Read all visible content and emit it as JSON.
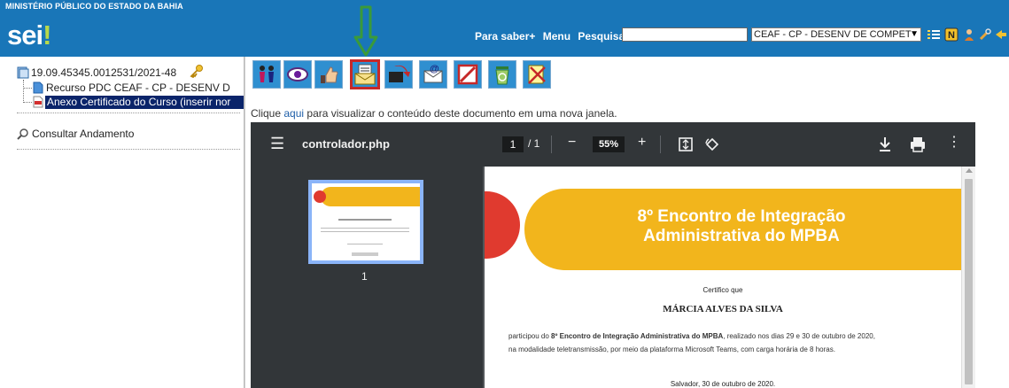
{
  "header": {
    "agency": "MINISTÉRIO PÚBLICO DO ESTADO DA BAHIA",
    "logo": "sei",
    "logo_mark": "!",
    "links": [
      "Para saber+",
      "Menu",
      "Pesquisa"
    ],
    "search_value": "",
    "unit_selected": "CEAF - CP - DESENV DE COMPET",
    "icons": [
      "list-icon",
      "notes-icon",
      "user-icon",
      "tools-icon",
      "exit-icon"
    ]
  },
  "tree": {
    "process_number": "19.09.45345.0012531/2021-48",
    "doc1": "Recurso PDC CEAF - CP - DESENV D",
    "doc2": "Anexo Certificado do Curso (inserir nor",
    "consult": "Consultar Andamento"
  },
  "actions": {
    "buttons": [
      "assign-icon",
      "view-icon",
      "approve-icon",
      "email-document-icon",
      "send-icon",
      "email-icon",
      "cancel-icon",
      "recycle-icon",
      "exclude-icon"
    ],
    "highlighted_index": 3,
    "arrow_color": "#3a9a3a",
    "highlight_color": "#c62828"
  },
  "info": {
    "prefix": "Clique",
    "link": "aqui",
    "suffix": "para visualizar o conteúdo deste documento em uma nova janela."
  },
  "viewer": {
    "filename": "controlador.php",
    "page_current": "1",
    "page_total": "/ 1",
    "zoom": "55%",
    "thumb_page": "1"
  },
  "certificate": {
    "title_line1": "8º Encontro de Integração",
    "title_line2": "Administrativa do MPBA",
    "subtitle": "Certifico que",
    "name": "MÁRCIA ALVES DA SILVA",
    "para_prefix": "participou do ",
    "para_bold": "8º Encontro de Integração Administrativa do MPBA",
    "para_suffix": ", realizado nos dias 29 e 30 de outubro de 2020,",
    "para_line2": "na modalidade teletransmissão, por meio da plataforma Microsoft Teams, com carga horária de 8 horas.",
    "city_date": "Salvador, 30 de outubro de 2020.",
    "banner_color": "#f2b51c",
    "circle_color": "#e03a2f"
  }
}
